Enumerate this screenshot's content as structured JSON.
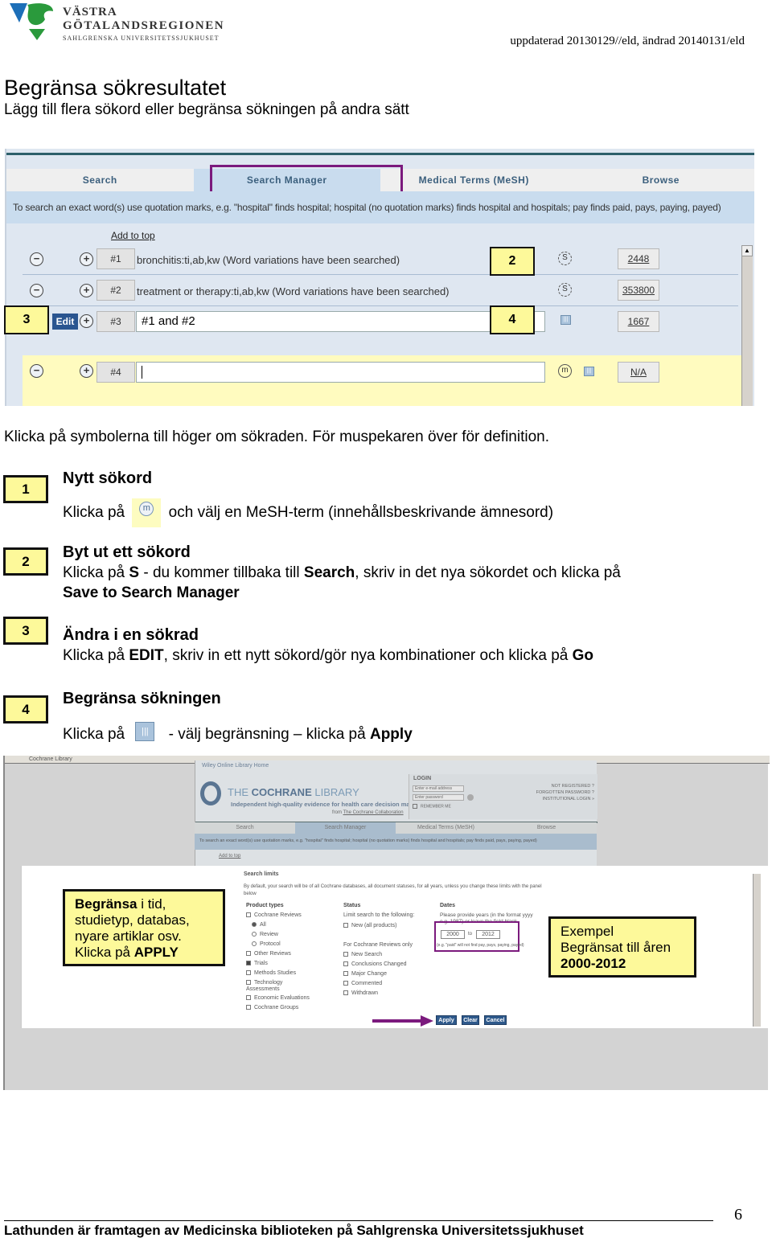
{
  "header": {
    "logo": {
      "line1": "VÄSTRA",
      "line2": "GÖTALANDSREGIONEN",
      "line3": "SAHLGRENSKA UNIVERSITETSSJUKHUSET",
      "colors": {
        "blue": "#1d6fb8",
        "green": "#2a9a3c"
      }
    },
    "updated": "uppdaterad 20130129//eld, ändrad  20140131/eld"
  },
  "title": "Begränsa sökresultatet",
  "subtitle": "Lägg till flera sökord eller begränsa sökningen på andra sätt",
  "screenshot1": {
    "tabs": [
      {
        "label": "Search",
        "active": false
      },
      {
        "label": "Search Manager",
        "active": true
      },
      {
        "label": "Medical Terms (MeSH)",
        "active": false
      },
      {
        "label": "Browse",
        "active": false
      }
    ],
    "hint": "To search an exact word(s) use quotation marks, e.g. \"hospital\" finds hospital; hospital (no quotation marks) finds hospital and hospitals; pay finds paid, pays, paying, payed)",
    "add_to_top": "Add to top",
    "rows": [
      {
        "num": "#1",
        "query": "bronchitis:ti,ab,kw (Word variations have been searched)",
        "count": "2448",
        "icon": "S"
      },
      {
        "num": "#2",
        "query": "treatment or therapy:ti,ab,kw (Word variations have been searched)",
        "count": "353800",
        "icon": "S"
      },
      {
        "num": "#3",
        "query": "#1 and #2",
        "count": "1667",
        "edit": "Edit"
      },
      {
        "num": "#4",
        "query": "",
        "count": "N/A",
        "icon": "m"
      }
    ],
    "callouts": {
      "c2": "2",
      "c3": "3",
      "c4": "4"
    },
    "highlight_color": "#7b1a7d"
  },
  "intro": "Klicka på symbolerna till höger om sökraden. För muspekaren över för definition.",
  "steps": [
    {
      "num": "1",
      "title": "Nytt sökord",
      "text_a": "Klicka på",
      "text_b": "och välj en MeSH-term  (innehållsbeskrivande ämnesord)"
    },
    {
      "num": "2",
      "title": "Byt ut ett sökord",
      "t1": "Klicka på ",
      "b1": "S",
      "t2": " - du kommer tillbaka till ",
      "b2": "Search",
      "t3": ", skriv in det nya sökordet och klicka på",
      "b3": "Save to Search Manager"
    },
    {
      "num": "3",
      "title": "Ändra i en sökrad",
      "t1": "Klicka på ",
      "b1": "EDIT",
      "t2": ", skriv in ett nytt sökord/gör nya kombinationer och klicka på ",
      "b2": "Go"
    },
    {
      "num": "4",
      "title": "Begränsa sökningen",
      "text_a": "Klicka på",
      "t2": " - välj begränsning – klicka på ",
      "b2": "Apply"
    }
  ],
  "screenshot2": {
    "browser_tab": "Cochrane Library",
    "wiley_link": "Wiley Online Library Home",
    "library_name_a": "THE ",
    "library_name_b": "COCHRANE",
    "library_name_c": " LIBRARY",
    "tagline": "Independent high-quality evidence for health care decision making",
    "from_prefix": "from ",
    "from_link": "The Cochrane Collaboration",
    "login": {
      "title": "LOGIN",
      "email_placeholder": "Enter e-mail address",
      "password_placeholder": "Enter password",
      "remember": "REMEMBER ME",
      "links": [
        "NOT REGISTERED ?",
        "FORGOTTEN PASSWORD ?",
        "INSTITUTIONAL LOGIN »"
      ]
    },
    "tabs": [
      "Search",
      "Search Manager",
      "Medical Terms (MeSH)",
      "Browse"
    ],
    "hint": "To search an exact word(s) use quotation marks, e.g. \"hospital\" finds hospital; hospital (no quotation marks) finds hospital and hospitals; pay finds paid, pays, paying, payed)",
    "add_to_top": "Add to top",
    "limits": {
      "title": "Search limits",
      "desc": "By default, your search will be of all Cochrane databases, all document statuses, for all years, unless you change these limits with the panel below",
      "product_types": {
        "heading": "Product types",
        "items": [
          {
            "label": "Cochrane Reviews",
            "type": "checkbox",
            "checked": false
          },
          {
            "label": "All",
            "type": "radio",
            "checked": true
          },
          {
            "label": "Review",
            "type": "radio",
            "checked": false
          },
          {
            "label": "Protocol",
            "type": "radio",
            "checked": false
          },
          {
            "label": "Other Reviews",
            "type": "checkbox",
            "checked": false
          },
          {
            "label": "Trials",
            "type": "checkbox",
            "checked": true
          },
          {
            "label": "Methods Studies",
            "type": "checkbox",
            "checked": false
          },
          {
            "label": "Technology Assessments",
            "type": "checkbox",
            "checked": false
          },
          {
            "label": "Economic Evaluations",
            "type": "checkbox",
            "checked": false
          },
          {
            "label": "Cochrane Groups",
            "type": "checkbox",
            "checked": false
          }
        ]
      },
      "status": {
        "heading": "Status",
        "limit_label": "Limit search to the following:",
        "new_all": "New (all products)",
        "for_reviews": "For Cochrane Reviews only",
        "items": [
          "New Search",
          "Conclusions Changed",
          "Major Change",
          "Commented",
          "Withdrawn"
        ]
      },
      "dates": {
        "heading": "Dates",
        "instruction": "Please provide years (in the format yyyy e.g. 1987) or leave the field blank",
        "from": "2000",
        "to_label": "to",
        "to": "2012",
        "note": "(e.g. \"paid\" will not find pay, pays, paying, payed)"
      },
      "buttons": {
        "apply": "Apply",
        "clear": "Clear",
        "cancel": "Cancel"
      }
    },
    "callout_left": {
      "bold": "Begränsa",
      "l1": " i tid,",
      "l2": "studietyp, databas,",
      "l3": "nyare artiklar osv.",
      "l4a": "Klicka på ",
      "l4b": "APPLY"
    },
    "callout_right": {
      "l1": "Exempel",
      "l2": "Begränsat till åren",
      "l3": "2000-2012"
    }
  },
  "footer": {
    "text": "Lathunden är framtagen av Medicinska biblioteken på Sahlgrenska Universitetssjukhuset",
    "page": "6"
  }
}
